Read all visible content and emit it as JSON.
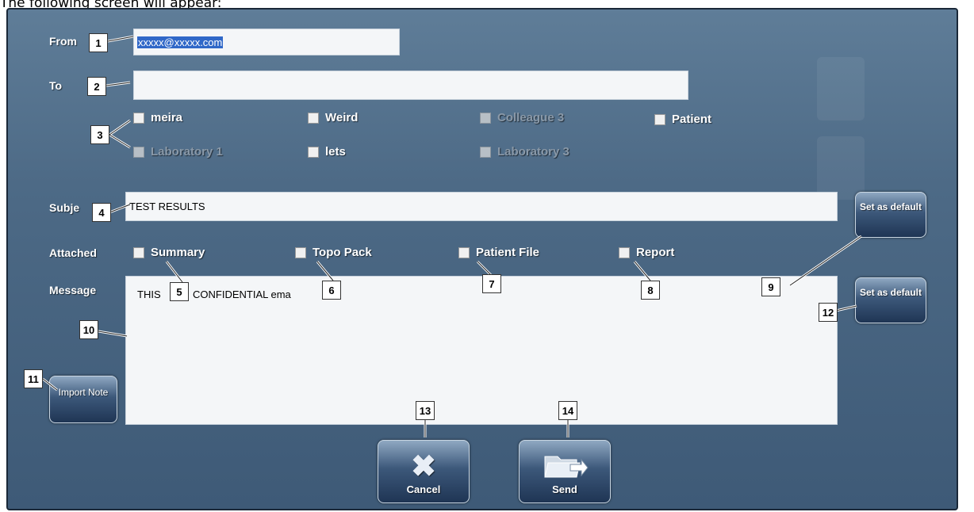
{
  "caption": "The following screen will appear:",
  "from": {
    "label": "From",
    "value": "xxxxx@xxxxx.com"
  },
  "to": {
    "label": "To",
    "value": ""
  },
  "contacts": [
    {
      "label": "meira",
      "enabled": true
    },
    {
      "label": "Weird",
      "enabled": true
    },
    {
      "label": "Colleague 3",
      "enabled": false
    },
    {
      "label": "Patient",
      "enabled": true
    },
    {
      "label": "Laboratory 1",
      "enabled": false
    },
    {
      "label": "lets",
      "enabled": true
    },
    {
      "label": "Laboratory 3",
      "enabled": false
    }
  ],
  "subject": {
    "label": "Subje",
    "value": "TEST RESULTS"
  },
  "attached": {
    "label": "Attached",
    "items": [
      {
        "label": "Summary"
      },
      {
        "label": "Topo Pack"
      },
      {
        "label": "Patient File"
      },
      {
        "label": "Report"
      }
    ]
  },
  "message": {
    "label": "Message",
    "text_left": "THIS",
    "text_right": "CONFIDENTIAL ema"
  },
  "buttons": {
    "set_default_1": "Set as default",
    "set_default_2": "Set as default",
    "import_note": "Import Note",
    "cancel": "Cancel",
    "send": "Send"
  },
  "callouts": [
    "1",
    "2",
    "3",
    "4",
    "5",
    "6",
    "7",
    "8",
    "9",
    "10",
    "11",
    "12",
    "13",
    "14"
  ],
  "colors": {
    "dialog_bg": "#4d6a86",
    "callout_bg": "#ffffff"
  }
}
